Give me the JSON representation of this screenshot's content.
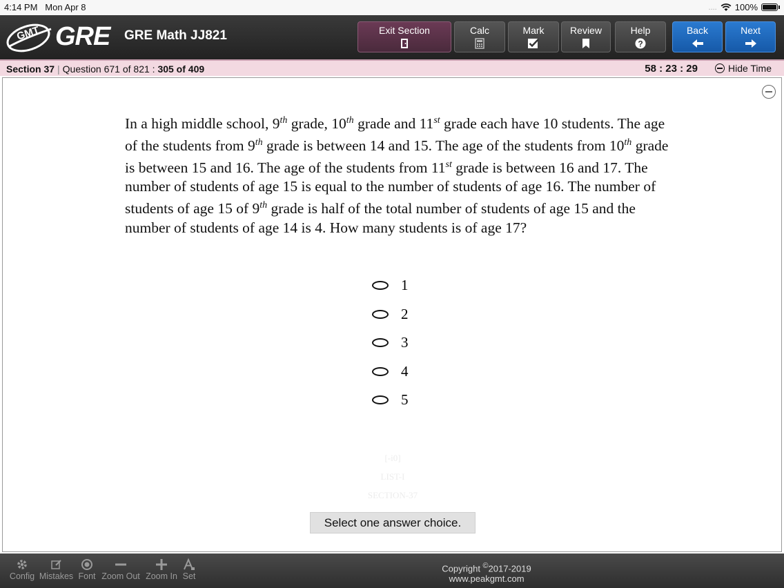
{
  "status_bar": {
    "time": "4:14 PM",
    "date": "Mon Apr 8",
    "dots": "....",
    "battery": "100%"
  },
  "header": {
    "logo_badge": "GMT",
    "logo_text": "GRE",
    "title": "GRE Math JJ821",
    "buttons": {
      "exit": "Exit Section",
      "calc": "Calc",
      "mark": "Mark",
      "review": "Review",
      "help": "Help",
      "back": "Back",
      "next": "Next"
    }
  },
  "info_bar": {
    "section": "Section 37",
    "question": "Question 671 of 821 : ",
    "progress": "305 of 409",
    "timer": "58 : 23 : 29",
    "hide_time": "Hide Time"
  },
  "question": {
    "t1": "In a high middle school, 9",
    "s1": "th",
    "t2": " grade, 10",
    "s2": "th",
    "t3": " grade and 11",
    "s3": "st",
    "t4": " grade each have 10 students. The age of the students from 9",
    "s4": "th",
    "t5": " grade is between 14 and 15. The age of the students from 10",
    "s5": "th",
    "t6": " grade is between 15 and 16. The age of the students from 11",
    "s6": "st",
    "t7": " grade is between 16 and 17. The number of students of age 15 is equal to the number of students of age 16. The number of students of age 15 of 9",
    "s7": "th",
    "t8": " grade is half of the total number of students of age 15 and the number of students of age 14 is 4. How many students is of age 17?"
  },
  "choices": [
    "1",
    "2",
    "3",
    "4",
    "5"
  ],
  "watermark": {
    "line1": "[-i0]",
    "line2": "LIST-I",
    "line3": "SECTION-37"
  },
  "hint": "Select one answer choice.",
  "footer": {
    "tools": {
      "config": "Config",
      "mistakes": "Mistakes",
      "font": "Font",
      "zoom_out": "Zoom Out",
      "zoom_in": "Zoom In",
      "set": "Set"
    },
    "copyright_prefix": "Copyright ",
    "copyright_mark": "©",
    "copyright_years": "2017-2019",
    "website": "www.peakgmt.com"
  }
}
